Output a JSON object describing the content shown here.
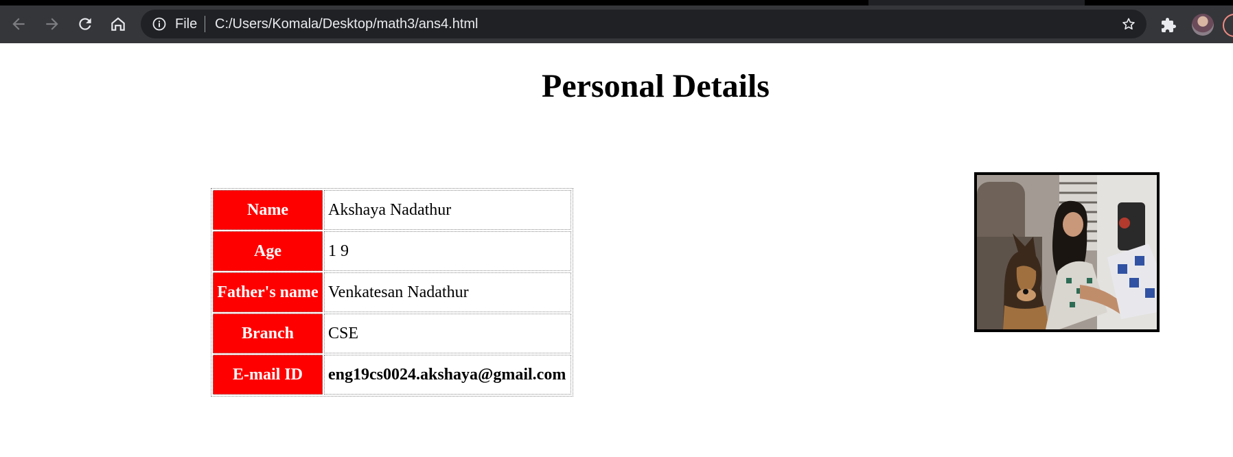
{
  "browser": {
    "omnibox": {
      "scheme_label": "File",
      "url": "C:/Users/Komala/Desktop/math3/ans4.html"
    },
    "icons": [
      "back-icon",
      "forward-icon",
      "reload-icon",
      "home-icon",
      "info-icon",
      "star-icon",
      "extensions-icon",
      "avatar"
    ],
    "colors": {
      "toolbar": "#35363a",
      "omnibox": "#202124",
      "text": "#e8eaed"
    }
  },
  "page": {
    "title": "Personal Details",
    "rows": [
      {
        "label": "Name",
        "value": "Akshaya Nadathur"
      },
      {
        "label": "Age",
        "value": "1 9"
      },
      {
        "label": "Father's name",
        "value": "Venkatesan Nadathur"
      },
      {
        "label": "Branch",
        "value": "CSE"
      },
      {
        "label": "E-mail ID",
        "value": "eng19cs0024.akshaya@gmail.com"
      }
    ],
    "colors": {
      "label_background": "#ff0000",
      "label_text": "#ffffff"
    },
    "photo": {
      "subject": "photo of girl with german shepherd dog"
    }
  }
}
